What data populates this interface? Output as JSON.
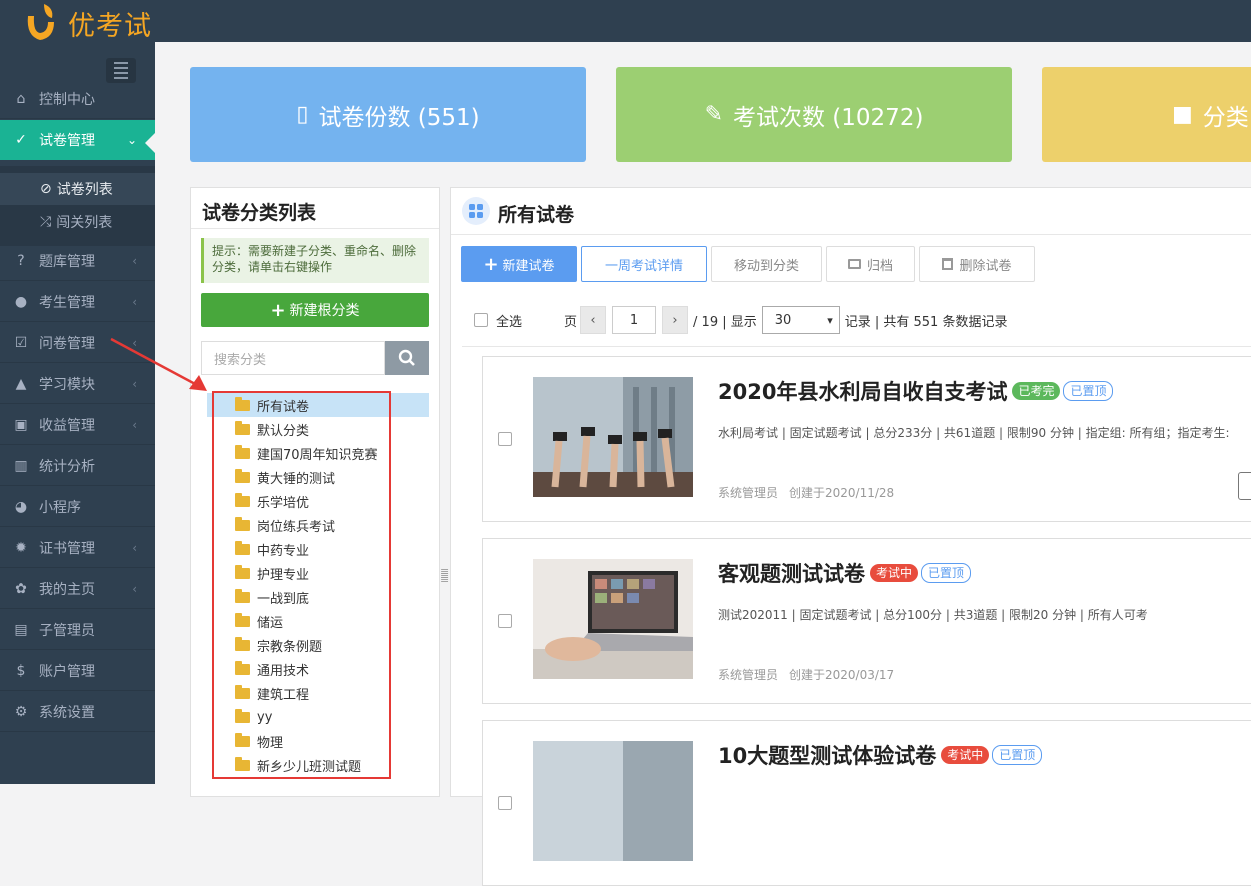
{
  "app": {
    "title": "优考试"
  },
  "sidebar": {
    "items": [
      {
        "label": "控制中心",
        "icon": "home-icon",
        "glyph": "⌂"
      },
      {
        "label": "试卷管理",
        "icon": "check-circle-icon",
        "glyph": "✓",
        "active": true
      },
      {
        "label": "题库管理",
        "icon": "question-circle-icon",
        "glyph": "?"
      },
      {
        "label": "考生管理",
        "icon": "user-icon",
        "glyph": "●"
      },
      {
        "label": "问卷管理",
        "icon": "checkbox-icon",
        "glyph": "☑"
      },
      {
        "label": "学习模块",
        "icon": "graduation-cap-icon",
        "glyph": "▲"
      },
      {
        "label": "收益管理",
        "icon": "money-icon",
        "glyph": "▣"
      },
      {
        "label": "统计分析",
        "icon": "bar-chart-icon",
        "glyph": "▥"
      },
      {
        "label": "小程序",
        "icon": "wechat-icon",
        "glyph": "◕"
      },
      {
        "label": "证书管理",
        "icon": "certificate-icon",
        "glyph": "✹"
      },
      {
        "label": "我的主页",
        "icon": "leaf-icon",
        "glyph": "✿"
      },
      {
        "label": "子管理员",
        "icon": "lock-icon",
        "glyph": "▤"
      },
      {
        "label": "账户管理",
        "icon": "dollar-icon",
        "glyph": "$"
      },
      {
        "label": "系统设置",
        "icon": "gear-icon",
        "glyph": "⚙"
      }
    ],
    "sub_items": [
      {
        "label": "试卷列表",
        "icon": "check-circle-icon",
        "glyph": "⊘"
      },
      {
        "label": "闯关列表",
        "icon": "shuffle-icon",
        "glyph": "⤮"
      }
    ]
  },
  "stats": [
    {
      "label": "试卷份数 (551)",
      "icon": "file-icon",
      "glyph": "▯",
      "color": "#74b3ef"
    },
    {
      "label": "考试次数 (10272)",
      "icon": "edit-icon",
      "glyph": "✎",
      "color": "#9ccf72"
    },
    {
      "label": "分类",
      "icon": "grid-icon",
      "glyph": "■",
      "color": "#edd06b"
    }
  ],
  "category_panel": {
    "title": "试卷分类列表",
    "tip": "提示：需要新建子分类、重命名、删除分类，请单击右键操作",
    "new_root_label": "新建根分类",
    "search_placeholder": "搜索分类",
    "tree": [
      "所有试卷",
      "默认分类",
      "建国70周年知识竞赛",
      "黄大锤的测试",
      "乐学培优",
      "岗位练兵考试",
      "中药专业",
      "护理专业",
      "一战到底",
      "储运",
      "宗教条例题",
      "通用技术",
      "建筑工程",
      "yy",
      "物理",
      "新乡少儿班测试题"
    ]
  },
  "main_panel": {
    "title": "所有试卷",
    "toolbar": {
      "new_exam": "新建试卷",
      "week_details": "一周考试详情",
      "move_to_category": "移动到分类",
      "archive": "归档",
      "delete_exam": "删除试卷"
    },
    "pager": {
      "select_all": "全选",
      "page_label": "页",
      "current_page": "1",
      "total_pages_label": "/ 19 | 显示",
      "page_size": "30",
      "records_label": "记录 | 共有 551 条数据记录"
    },
    "exams": [
      {
        "title": "2020年县水利局自收自支考试",
        "status": "已考完",
        "status_type": "green",
        "pinned": "已置顶",
        "meta": "水利局考试 | 固定试题考试 | 总分233分 | 共61道题 | 限制90 分钟 | 指定组: 所有组；指定考生:",
        "author": "系统管理员",
        "created": "创建于2020/11/28"
      },
      {
        "title": "客观题测试试卷",
        "status": "考试中",
        "status_type": "red",
        "pinned": "已置顶",
        "meta": "测试202011 | 固定试题考试 | 总分100分 | 共3道题 | 限制20 分钟 | 所有人可考",
        "author": "系统管理员",
        "created": "创建于2020/03/17"
      },
      {
        "title": "10大题型测试体验试卷",
        "status": "考试中",
        "status_type": "red",
        "pinned": "已置顶",
        "meta": "",
        "author": "",
        "created": ""
      }
    ]
  }
}
